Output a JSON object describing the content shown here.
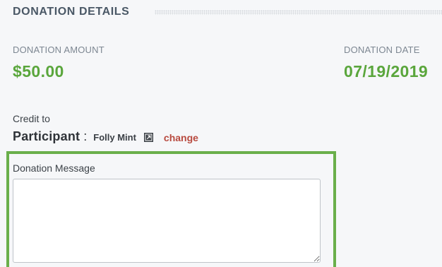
{
  "section": {
    "title": "DONATION DETAILS"
  },
  "donation_amount": {
    "label": "DONATION AMOUNT",
    "value": "$50.00"
  },
  "donation_date": {
    "label": "DONATION DATE",
    "value": "07/19/2019"
  },
  "credit": {
    "label": "Credit to",
    "participant_label": "Participant",
    "colon": ":",
    "participant_name": "Folly Mint",
    "open_icon": "external-link-icon",
    "change_label": "change"
  },
  "message": {
    "label": "Donation Message",
    "value": "",
    "placeholder": ""
  },
  "colors": {
    "accent_green": "#5aa63c",
    "highlight_border": "#6aaf4b",
    "change_link": "#b84a3f"
  }
}
